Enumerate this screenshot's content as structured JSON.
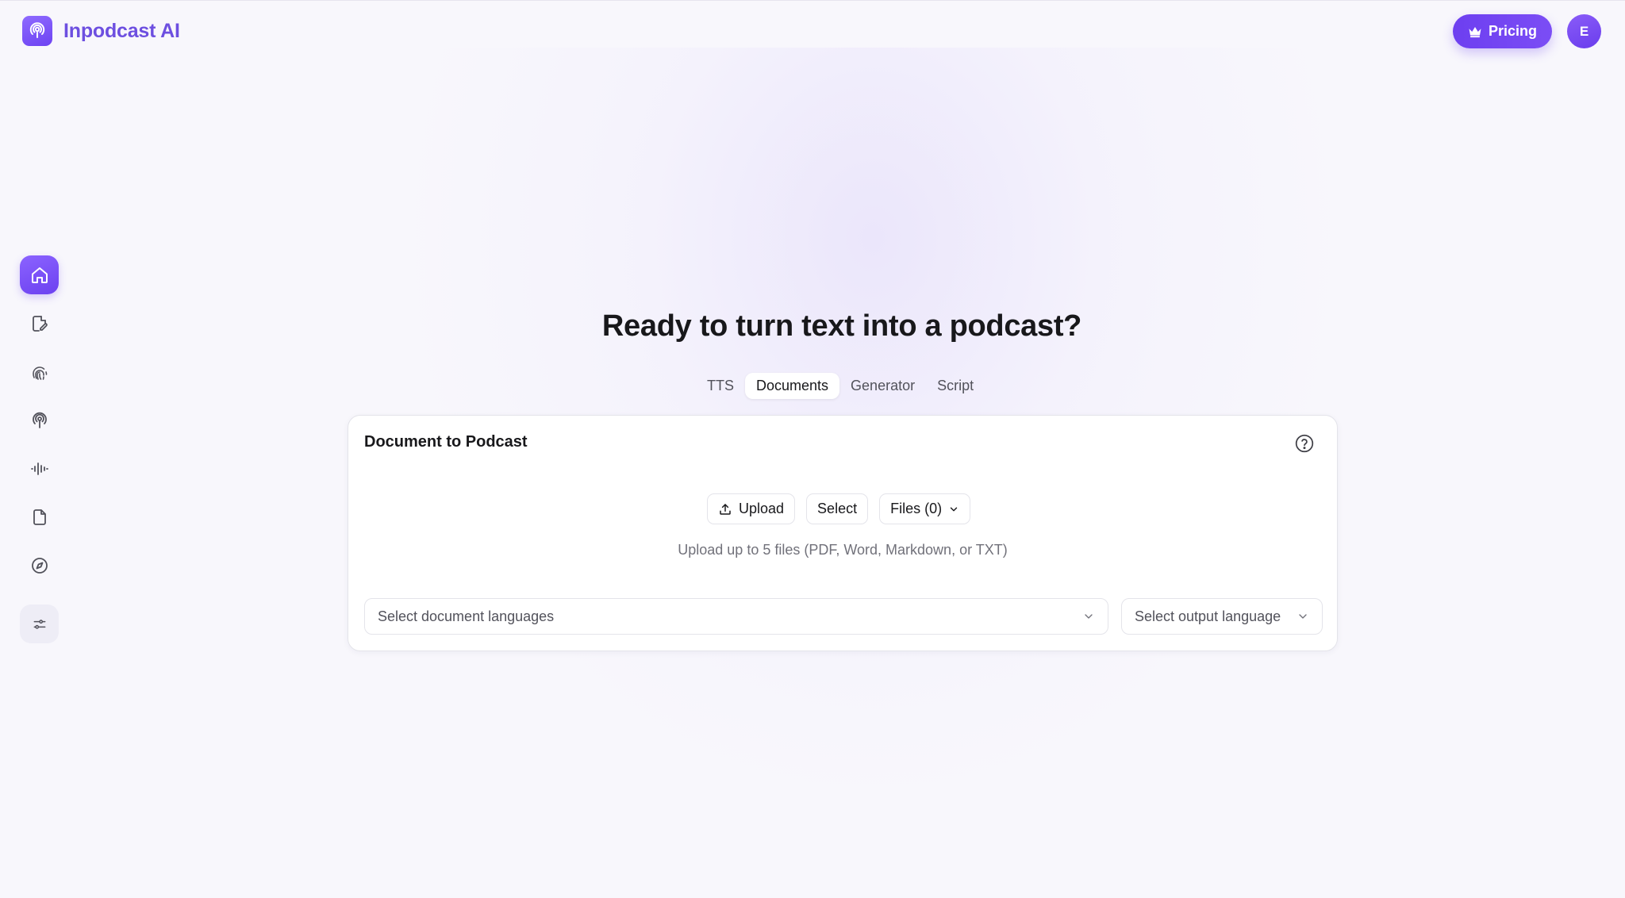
{
  "app": {
    "name": "Inpodcast AI",
    "accent": "#6d3ff0",
    "icon": "podcast-icon"
  },
  "header": {
    "pricing_label": "Pricing",
    "pricing_icon": "crown-icon",
    "avatar_initial": "E"
  },
  "sidebar": {
    "items": [
      {
        "name": "home",
        "icon": "home-icon",
        "active": true
      },
      {
        "name": "editor",
        "icon": "edit-document-icon"
      },
      {
        "name": "voice-clone",
        "icon": "fingerprint-icon"
      },
      {
        "name": "podcast",
        "icon": "podcast-icon"
      },
      {
        "name": "audio",
        "icon": "audio-waveform-icon"
      },
      {
        "name": "documents",
        "icon": "file-icon"
      },
      {
        "name": "explore",
        "icon": "compass-icon"
      },
      {
        "name": "settings",
        "icon": "sliders-icon"
      }
    ]
  },
  "main": {
    "headline": "Ready to turn text into a podcast?",
    "tabs": [
      {
        "label": "TTS",
        "active": false
      },
      {
        "label": "Documents",
        "active": true
      },
      {
        "label": "Generator",
        "active": false
      },
      {
        "label": "Script",
        "active": false
      }
    ]
  },
  "card": {
    "title": "Document to Podcast",
    "help_icon": "help-circle-icon",
    "upload_label": "Upload",
    "select_label": "Select",
    "files_label": "Files (0)",
    "hint": "Upload up to 5 files (PDF, Word, Markdown, or TXT)",
    "doc_lang_placeholder": "Select document languages",
    "output_lang_placeholder": "Select output language"
  }
}
